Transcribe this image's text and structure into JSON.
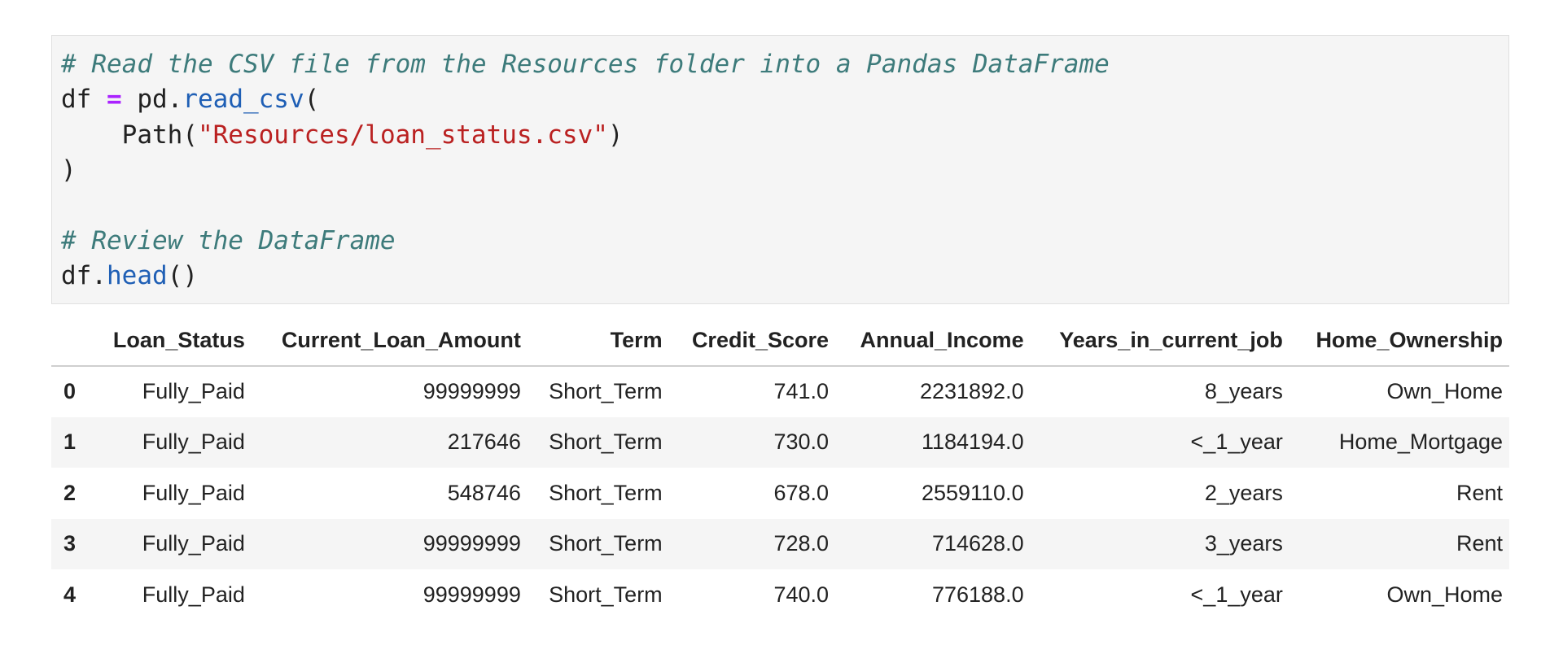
{
  "code_cell": {
    "lines": [
      [
        {
          "t": "comment",
          "v": "# Read the CSV file from the Resources folder into a Pandas DataFrame"
        }
      ],
      [
        {
          "t": "plain",
          "v": "df "
        },
        {
          "t": "op",
          "v": "="
        },
        {
          "t": "plain",
          "v": " pd."
        },
        {
          "t": "fn",
          "v": "read_csv"
        },
        {
          "t": "plain",
          "v": "("
        }
      ],
      [
        {
          "t": "plain",
          "v": "    Path("
        },
        {
          "t": "str",
          "v": "\"Resources/loan_status.csv\""
        },
        {
          "t": "plain",
          "v": ")"
        }
      ],
      [
        {
          "t": "plain",
          "v": ")"
        }
      ],
      [],
      [
        {
          "t": "comment",
          "v": "# Review the DataFrame"
        }
      ],
      [
        {
          "t": "plain",
          "v": "df."
        },
        {
          "t": "fn",
          "v": "head"
        },
        {
          "t": "plain",
          "v": "()"
        }
      ]
    ]
  },
  "output_table": {
    "columns": [
      "Loan_Status",
      "Current_Loan_Amount",
      "Term",
      "Credit_Score",
      "Annual_Income",
      "Years_in_current_job",
      "Home_Ownership"
    ],
    "rows": [
      {
        "index": "0",
        "cells": [
          "Fully_Paid",
          "99999999",
          "Short_Term",
          "741.0",
          "2231892.0",
          "8_years",
          "Own_Home"
        ]
      },
      {
        "index": "1",
        "cells": [
          "Fully_Paid",
          "217646",
          "Short_Term",
          "730.0",
          "1184194.0",
          "<_1_year",
          "Home_Mortgage"
        ]
      },
      {
        "index": "2",
        "cells": [
          "Fully_Paid",
          "548746",
          "Short_Term",
          "678.0",
          "2559110.0",
          "2_years",
          "Rent"
        ]
      },
      {
        "index": "3",
        "cells": [
          "Fully_Paid",
          "99999999",
          "Short_Term",
          "728.0",
          "714628.0",
          "3_years",
          "Rent"
        ]
      },
      {
        "index": "4",
        "cells": [
          "Fully_Paid",
          "99999999",
          "Short_Term",
          "740.0",
          "776188.0",
          "<_1_year",
          "Own_Home"
        ]
      }
    ]
  }
}
